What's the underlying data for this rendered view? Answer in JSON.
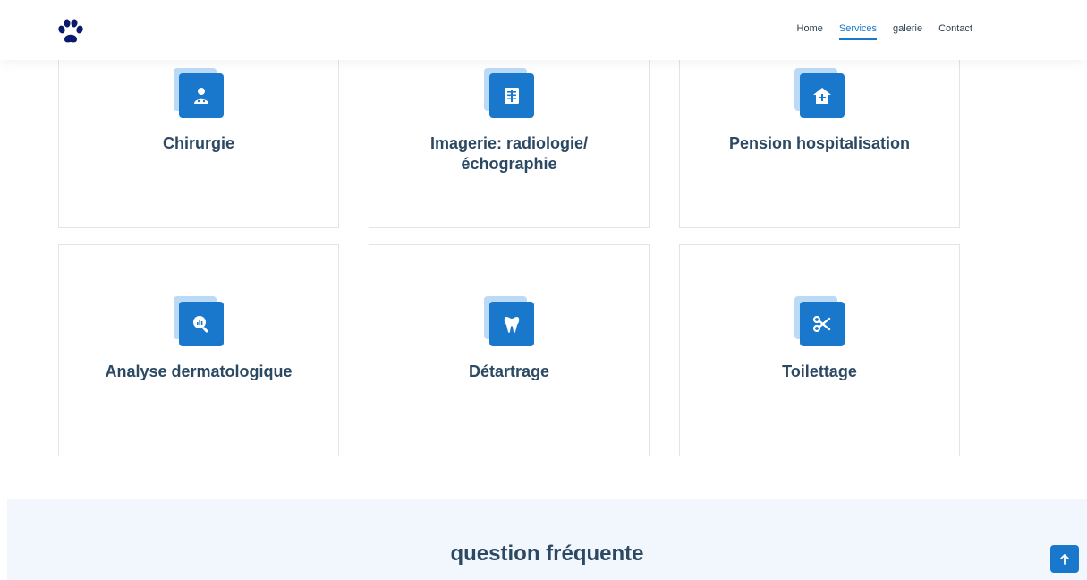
{
  "header": {
    "logo_icon": "paw-print-icon",
    "nav": [
      {
        "label": "Home",
        "active": false
      },
      {
        "label": "Services",
        "active": true
      },
      {
        "label": "galerie",
        "active": false
      },
      {
        "label": "Contact",
        "active": false
      }
    ]
  },
  "services": [
    {
      "title": "Chirurgie",
      "icon": "surgeon-icon"
    },
    {
      "title": "Imagerie: radiologie/ échographie",
      "icon": "xray-icon"
    },
    {
      "title": "Pension hospitalisation",
      "icon": "house-medical-icon"
    },
    {
      "title": "Analyse dermatologique",
      "icon": "magnifier-chart-icon"
    },
    {
      "title": "Détartrage",
      "icon": "tooth-icon"
    },
    {
      "title": "Toilettage",
      "icon": "scissors-icon"
    }
  ],
  "faq": {
    "title": "question fréquente"
  },
  "back_to_top_icon": "arrow-up-icon",
  "colors": {
    "accent": "#1977cc",
    "accent_light": "#badaf7",
    "heading": "#2c4964",
    "faq_bg": "#f1f7fd"
  }
}
